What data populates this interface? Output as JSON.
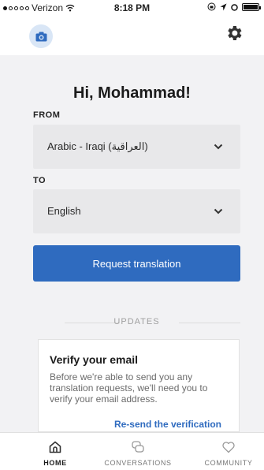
{
  "status_bar": {
    "carrier": "Verizon",
    "time": "8:18 PM"
  },
  "header": {
    "camera_icon": "camera-icon",
    "settings_icon": "gear-icon"
  },
  "greeting": "Hi, Mohammad!",
  "from": {
    "label": "FROM",
    "value": "Arabic - Iraqi (العراقية)"
  },
  "to": {
    "label": "TO",
    "value": "English"
  },
  "request_button": "Request translation",
  "updates_label": "UPDATES",
  "verify_card": {
    "title": "Verify your email",
    "body": "Before we're able to send you any translation requests, we'll need you to verify your email address.",
    "link": "Re-send the verification"
  },
  "tabs": [
    {
      "label": "HOME",
      "icon": "home-icon",
      "active": true
    },
    {
      "label": "CONVERSATIONS",
      "icon": "chat-bubbles-icon",
      "active": false
    },
    {
      "label": "COMMUNITY",
      "icon": "heart-icon",
      "active": false
    }
  ],
  "colors": {
    "accent": "#2f6bbf",
    "background": "#f2f2f4",
    "field": "#e8e8ea"
  }
}
